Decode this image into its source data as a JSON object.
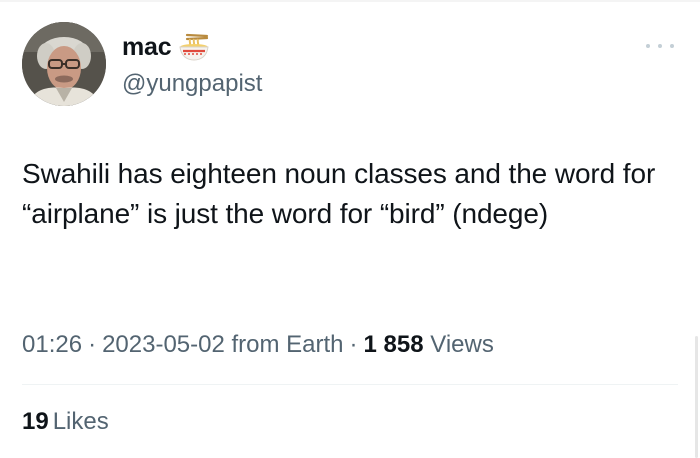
{
  "author": {
    "display_name": "mac",
    "handle": "@yungpapist",
    "name_emoji": "ramen-bowl-icon",
    "avatar": "avatar-photo"
  },
  "tweet": {
    "text": "Swahili has eighteen noun classes and the word for “airplane” is just the word for “bird” (ndege)"
  },
  "meta": {
    "time": "01:26",
    "separator": "·",
    "date": "2023-05-02",
    "source": "from Earth",
    "views_count": "1 858",
    "views_label": "Views"
  },
  "engagement": {
    "likes_count": "19",
    "likes_label": "Likes"
  },
  "colors": {
    "text_primary": "#0f1419",
    "text_secondary": "#536471",
    "divider": "#eff3f4",
    "background": "#ffffff"
  }
}
